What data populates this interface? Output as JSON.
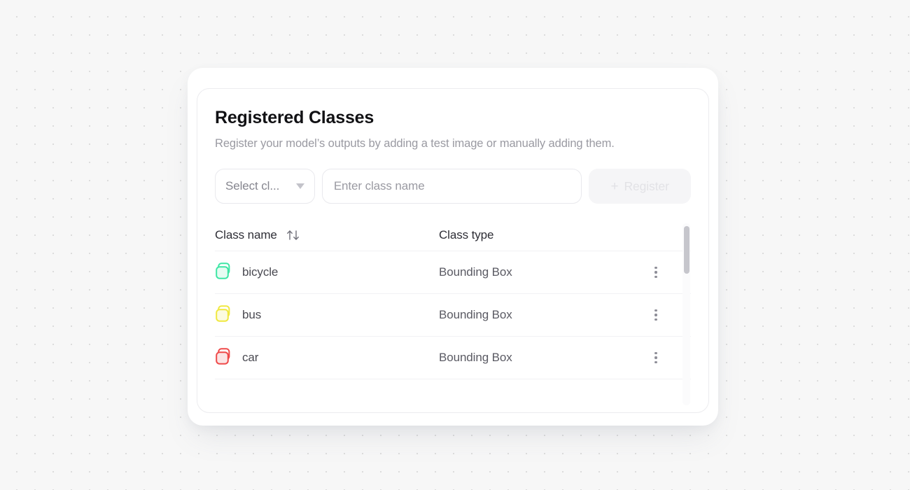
{
  "card": {
    "title": "Registered Classes",
    "subtitle": "Register your model’s outputs by adding a test image or manually adding them."
  },
  "controls": {
    "select": {
      "name": "class-type-select",
      "value": "Select cl...",
      "caret_icon": "chevron-down-icon"
    },
    "class_name_input": {
      "name": "class-name-input",
      "value": "",
      "placeholder": "Enter class name"
    },
    "register_button": {
      "label": "Register",
      "plus_icon": "plus-icon",
      "disabled": true
    }
  },
  "table": {
    "columns": [
      {
        "key": "class_name",
        "label": "Class name",
        "sortable": true,
        "sort_icon": "sort-arrows-icon"
      },
      {
        "key": "class_type",
        "label": "Class type",
        "sortable": false
      }
    ],
    "rows": [
      {
        "class_name": "bicycle",
        "class_type": "Bounding Box",
        "color": "#3ee6a5",
        "menu_icon": "kebab-menu-icon"
      },
      {
        "class_name": "bus",
        "class_type": "Bounding Box",
        "color": "#f0e840",
        "menu_icon": "kebab-menu-icon"
      },
      {
        "class_name": "car",
        "class_type": "Bounding Box",
        "color": "#ef4a4a",
        "menu_icon": "kebab-menu-icon"
      }
    ]
  },
  "scrollbar": {
    "name": "table-scrollbar",
    "thumb_name": "table-scrollbar-thumb"
  }
}
